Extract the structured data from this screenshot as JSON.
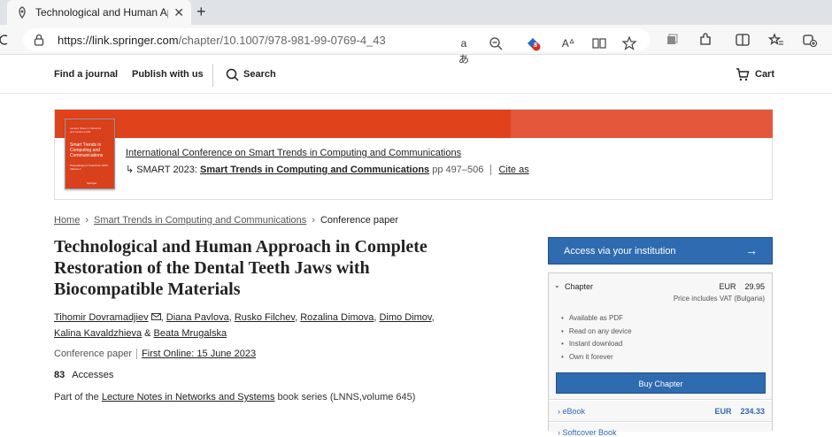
{
  "browser": {
    "tab_title": "Technological and Human Approach in Complete",
    "url_host": "https://link.springer.com",
    "url_path": "/chapter/10.1007/978-981-99-0769-4_43",
    "extension_badge": "8",
    "new_tab_glyph": "+",
    "close_glyph": "✕"
  },
  "header": {
    "find_journal": "Find a journal",
    "publish": "Publish with us",
    "search": "Search",
    "cart": "Cart"
  },
  "banner": {
    "cover_series": "Lecture Notes in Networks and Systems 645",
    "cover_title": "Smart Trends in Computing and Communications",
    "cover_subtitle": "Proceedings of SmartCom 2023, Volume 1",
    "cover_publisher": "Springer",
    "conference_link": "International Conference on Smart Trends in Computing and Communications",
    "arrow": "↳",
    "conf_prefix": "SMART 2023:",
    "book_title": "Smart Trends in Computing and Communications",
    "pages": "pp 497–506",
    "cite_as": "Cite as"
  },
  "breadcrumb": {
    "home": "Home",
    "book": "Smart Trends in Computing and Communications",
    "current": "Conference paper",
    "sep": "›"
  },
  "article": {
    "title": "Technological and Human Approach in Complete Restoration of the Dental Teeth Jaws with Biocompatible Materials",
    "authors": [
      "Tihomir Dovramadjiev",
      "Diana Pavlova",
      "Rusko Filchev",
      "Rozalina Dimova",
      "Dimo Dimov",
      "Kalina Kavaldzhieva",
      "Beata Mrugalska"
    ],
    "author_and": "&",
    "type": "Conference paper",
    "first_online": "First Online: 15 June 2023",
    "accesses_count": "83",
    "accesses_label": "Accesses",
    "part_of_prefix": "Part of the",
    "series_link": "Lecture Notes in Networks and Systems",
    "series_suffix": "book series (LNNS,volume 645)"
  },
  "purchase": {
    "access_label": "Access via your institution",
    "access_arrow": "→",
    "chapter_label": "Chapter",
    "currency": "EUR",
    "chapter_price": "29.95",
    "vat_note": "Price includes VAT (Bulgaria)",
    "features": [
      "Available as PDF",
      "Read on any device",
      "Instant download",
      "Own it forever"
    ],
    "buy_label": "Buy Chapter",
    "ebook_label": "eBook",
    "ebook_price": "234.33",
    "next_label": "Softcover Book",
    "caret_down": "⌄",
    "caret_right": "›"
  },
  "colors": {
    "accent_blue": "#2f6bb0",
    "banner_red": "#e0421c"
  }
}
